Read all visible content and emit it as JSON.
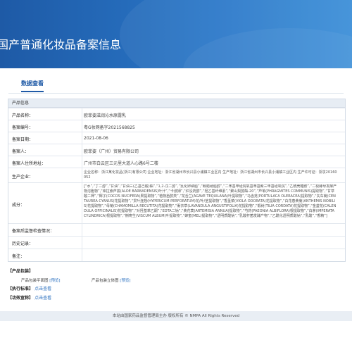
{
  "banner": {
    "title": "国产普通化妆品备案信息"
  },
  "tabs": [
    {
      "label": "数据查看"
    }
  ],
  "product": {
    "section_title": "产品信息",
    "rows": {
      "name": {
        "label": "产品名称：",
        "value": "欧菲姿滋润沁水原露乳"
      },
      "record_no": {
        "label": "备案编号：",
        "value": "粤G妆网备字2021568825"
      },
      "record_date": {
        "label": "备案日期：",
        "value": "2021-08-06"
      },
      "registrant": {
        "label": "备案人：",
        "value": "欧菲姿（广州）贸易有限公司"
      },
      "address": {
        "label": "备案人住所地址：",
        "value": "广州市白云区三元里大道人心路6号二楼"
      },
      "manufacturer": {
        "label": "生产企业：",
        "value": "企业名称：浙江某化妆品(浙江)有限公司 企业地址：浙江省湖州市长兴县小浦镇工业区内 生产地址：浙江省湖州市长兴县小浦镇工业区内 生产许可证：浙妆20160052"
      },
      "ingredients": {
        "label": "成分：",
        "value": "[“水”,“丁二醇”,“甘油”,“甘油三(乙基己酸)酯”,“1,2-戊二醇”,“氢化卵磷脂”,“鲸蜡硬脂醇”,“二苯基甲硅烷氧基苯基聚三甲基硅氧烷”,“乙酰壳糖胺”,“二裂酵母发酵产物溶胞物”,“库拉索芦荟(ALOE BARBADENSIS)叶汁”,“卡波姆”,“红没药醇”,“羟乙基纤维素”,“聚山梨醇酯-20”,“芦苇(PHRAGMITES COMMUNIS)提取物”,“甘草酸二钾”,“椰子(COCOS NUCIFERA)果提取物”,“植物甾醇类”,“龙舌兰(AGAVE TEQUILANA)叶提取物”,“马齿苋(PORTULACA OLERACEA)提取物”,“矢车菊(CENTAUREA CYANUS)花提取物”,“贯叶连翘(HYPERICUM PERFORATUM)花/叶/茎提取物”,“香堇菜(VIOLA ODORATA)花提取物”,“白花春黄菊(ANTHEMIS NOBILIS)花提取物”,“母菊(CHAMOMILLA RECUTITA)花提取物”,“薰衣草(LAVANDULA ANGUSTIFOLIA)花提取物”,“椴树(TILIA CORDATA)花提取物”,“金盏花(CALENDULA OFFICINALIS)花提取物”,“对羟基苯乙酮”,“EDTA二钠”,“黄花蒿(ARTEMISIA ANNUA)提取物”,“芍药(PAEONIA ALBIFLORA)根提取物”,“白茅(IMPERATA CYLINDRICA)根提取物”,“槲寄生(VISCUM ALBUM)叶提取物”,“蜂蜜(MEL)提取物”,“透明质酸钠”,“乳酸杆菌发酵产物”,“乙酰化透明质酸钠”,“乳酸”,“香精”]"
      },
      "review": {
        "label": "备案后监督检查情况：",
        "value": ""
      },
      "history": {
        "label": "历史记录：",
        "value": ""
      },
      "remark": {
        "label": "备注：",
        "value": ""
      }
    }
  },
  "packaging": {
    "title": "产品包装",
    "flat_label": "产品包装平面图",
    "flat_link": "[预览]",
    "solid_label": "产品包装立体图",
    "solid_link": "[预览]"
  },
  "standard": {
    "title": "执行标准",
    "link": "点击查看"
  },
  "efficacy": {
    "title": "功效宣称",
    "link": "点击查看"
  },
  "footer": {
    "text": "本站由国家药品监督管理局主办 版权所有 © NMPA All Rights Reserved"
  }
}
